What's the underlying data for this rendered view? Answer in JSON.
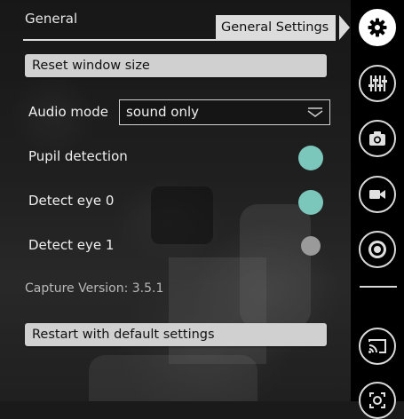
{
  "panel": {
    "title": "General",
    "reset_button": "Reset window size",
    "audio_mode": {
      "label": "Audio mode",
      "value": "sound only"
    },
    "settings": [
      {
        "label": "Pupil detection",
        "enabled": true
      },
      {
        "label": "Detect eye 0",
        "enabled": true
      },
      {
        "label": "Detect eye 1",
        "enabled": false
      }
    ],
    "capture_version": "Capture Version: 3.5.1",
    "restart_button": "Restart with default settings"
  },
  "tooltip": {
    "text": "General Settings"
  },
  "sidebar": {
    "items": [
      {
        "icon": "gear-icon",
        "active": true
      },
      {
        "icon": "sliders-icon",
        "active": false
      },
      {
        "icon": "camera-icon",
        "active": false
      },
      {
        "icon": "video-icon",
        "active": false
      },
      {
        "icon": "record-icon",
        "active": false
      },
      {
        "icon": "cast-icon",
        "active": false
      },
      {
        "icon": "capture-icon",
        "active": false
      }
    ]
  },
  "colors": {
    "toggle_on": "#7cc7bc",
    "toggle_off": "#9a9a9a",
    "tooltip_bg": "#dcdcdc",
    "sidebar_bg": "#000000"
  }
}
